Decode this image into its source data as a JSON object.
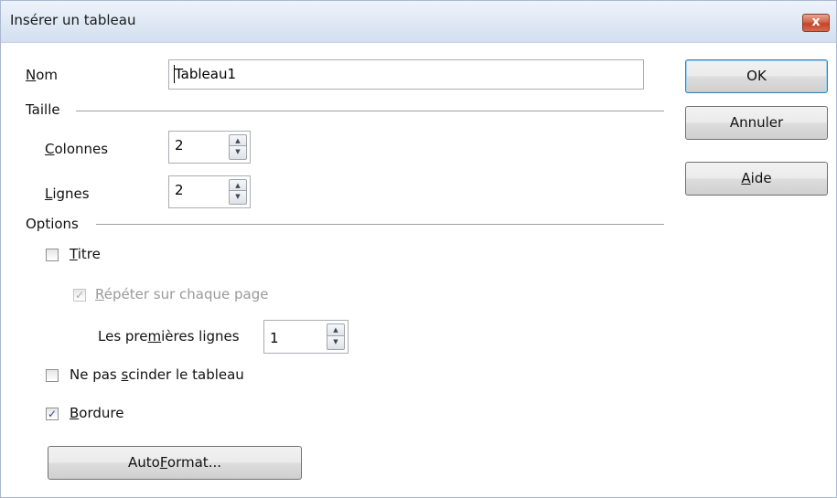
{
  "window": {
    "title": "Insérer un tableau",
    "close_glyph": "x",
    "close_color": "#c7452b"
  },
  "name": {
    "label_accel": "N",
    "label_rest": "om",
    "value": "Tableau1"
  },
  "taille": {
    "heading": "Taille",
    "columns": {
      "label_accel": "C",
      "label_rest": "olonnes",
      "value": "2"
    },
    "rows": {
      "label_accel": "L",
      "label_rest": "ignes",
      "value": "2"
    }
  },
  "options": {
    "heading": "Options",
    "title_check": {
      "label_accel": "T",
      "label_rest": "itre",
      "checked": false
    },
    "repeat_check": {
      "label_accel": "R",
      "label_rest": "épéter sur chaque page",
      "checked": true,
      "enabled": false
    },
    "first_rows": {
      "label_pre": "Les pre",
      "label_accel": "m",
      "label_post": "ières lignes",
      "value": "1"
    },
    "no_split_check": {
      "label_pre": "Ne pas ",
      "label_accel": "s",
      "label_post": "cinder le tableau",
      "checked": false
    },
    "border_check": {
      "label_accel": "B",
      "label_rest": "ordure",
      "checked": true
    }
  },
  "buttons": {
    "autoformat": {
      "pre": "Auto",
      "accel": "F",
      "post": "ormat..."
    },
    "ok": "OK",
    "cancel": "Annuler",
    "help": {
      "accel": "A",
      "rest": "ide"
    }
  },
  "glyphs": {
    "check": "✓",
    "spin_up": "▲",
    "spin_down": "▼"
  }
}
